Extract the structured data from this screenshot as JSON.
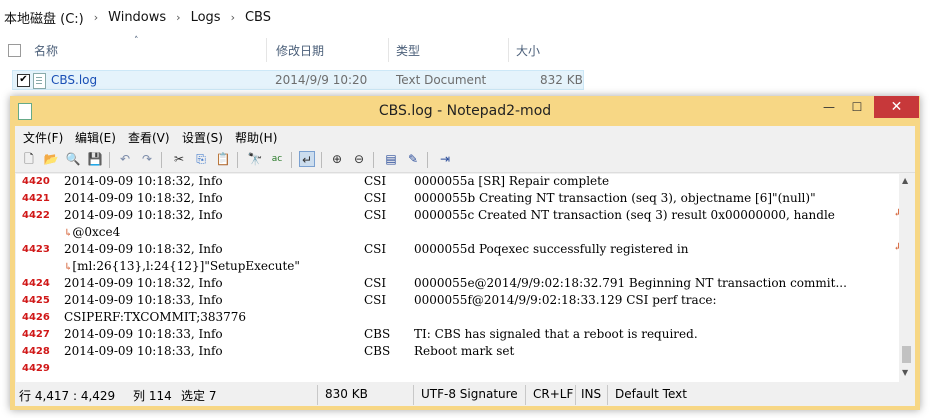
{
  "explorer": {
    "breadcrumb": [
      "本地磁盘 (C:)",
      "Windows",
      "Logs",
      "CBS"
    ],
    "breadcrumb_sep": "›",
    "columns": {
      "name": "名称",
      "date": "修改日期",
      "type": "类型",
      "size": "大小"
    },
    "sort_indicator": "˄",
    "file": {
      "name": "CBS.log",
      "date": "2014/9/9 10:20",
      "type": "Text Document",
      "size": "832 KB",
      "checked": true
    }
  },
  "notepad": {
    "title": "CBS.log - Notepad2-mod",
    "window_buttons": {
      "minimize": "—",
      "maximize": "☐",
      "close": "✕"
    },
    "menu": [
      "文件(F)",
      "编辑(E)",
      "查看(V)",
      "设置(S)",
      "帮助(H)"
    ],
    "lines": [
      {
        "num": "4420",
        "date": "2014-09-09 10:18:32, Info",
        "comp": "CSI",
        "msg": "0000055a [SR] Repair complete"
      },
      {
        "num": "4421",
        "date": "2014-09-09 10:18:32, Info",
        "comp": "CSI",
        "msg": "0000055b Creating NT transaction (seq 3), objectname [6]\"(null)\""
      },
      {
        "num": "4422",
        "date": "2014-09-09 10:18:32, Info",
        "comp": "CSI",
        "msg": "0000055c Created NT transaction (seq 3) result 0x00000000, handle",
        "cont": "@0xce4"
      },
      {
        "num": "4423",
        "date": "2014-09-09 10:18:32, Info",
        "comp": "CSI",
        "msg": "0000055d Poqexec successfully registered in",
        "cont": "[ml:26{13},l:24{12}]\"SetupExecute\""
      },
      {
        "num": "4424",
        "date": "2014-09-09 10:18:32, Info",
        "comp": "CSI",
        "msg": "0000055e@2014/9/9:02:18:32.791 Beginning NT transaction commit..."
      },
      {
        "num": "4425",
        "date": "2014-09-09 10:18:33, Info",
        "comp": "CSI",
        "msg": "0000055f@2014/9/9:02:18:33.129 CSI perf trace:"
      },
      {
        "num": "4426",
        "date": "CSIPERF:TXCOMMIT;383776",
        "comp": "",
        "msg": ""
      },
      {
        "num": "4427",
        "date": "2014-09-09 10:18:33, Info",
        "comp": "CBS",
        "msg": "TI: CBS has signaled that a reboot is required."
      },
      {
        "num": "4428",
        "date": "2014-09-09 10:18:33, Info",
        "comp": "CBS",
        "msg": "Reboot mark set"
      },
      {
        "num": "4429",
        "date": "",
        "comp": "",
        "msg": ""
      }
    ],
    "status": {
      "position": "行 4,417 : 4,429",
      "column": "列 114",
      "selection": "选定 7",
      "size": "830 KB",
      "encoding": "UTF-8 Signature",
      "eol": "CR+LF",
      "mode": "INS",
      "scheme": "Default Text"
    }
  }
}
